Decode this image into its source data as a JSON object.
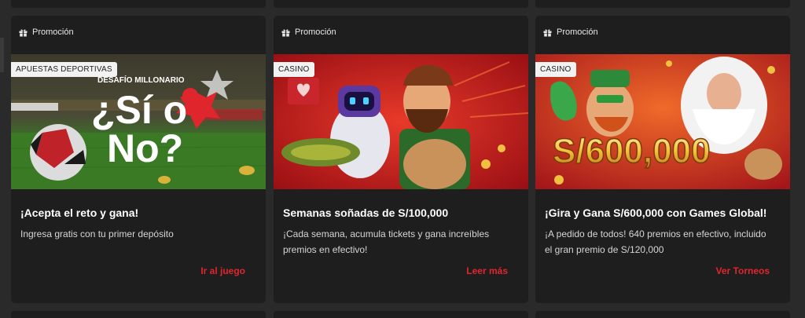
{
  "cards": [
    {
      "promo_label": "Promoción",
      "tag": "APUESTAS DEPORTIVAS",
      "banner_overline": "DESAFÍO MILLONARIO",
      "banner_text_1": "¿Sí o",
      "banner_text_2": "No?",
      "title": "¡Acepta el reto y gana!",
      "description": "Ingresa gratis con tu primer depósito",
      "cta": "Ir al juego"
    },
    {
      "promo_label": "Promoción",
      "tag": "CASINO",
      "title": "Semanas soñadas de S/100,000",
      "description": "¡Cada semana, acumula tickets y gana increíbles premios en efectivo!",
      "cta": "Leer más"
    },
    {
      "promo_label": "Promoción",
      "tag": "CASINO",
      "banner_text_1": "S/600,000",
      "title": "¡Gira y Gana S/600,000 con Games Global!",
      "description": "¡A pedido de todos! 640 premios en efectivo, incluido el gran premio de S/120,000",
      "cta": "Ver Torneos"
    }
  ],
  "colors": {
    "page_bg": "#2a2a2a",
    "card_bg": "#1e1e1e",
    "accent_red": "#e0262d",
    "tag_bg": "#f2f2f2"
  },
  "icons": {
    "promo": "gift-icon"
  }
}
